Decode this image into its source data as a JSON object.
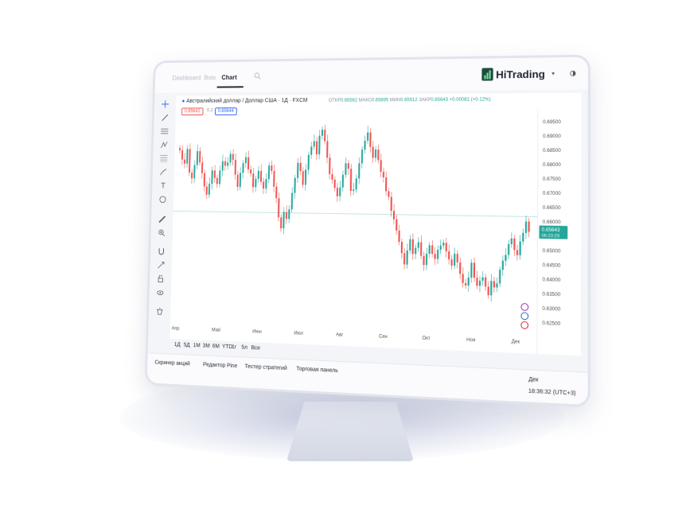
{
  "nav": {
    "tabs": [
      {
        "label": "Dashboard",
        "active": false
      },
      {
        "label": "Bots",
        "active": false
      },
      {
        "label": "Chart",
        "active": true
      }
    ],
    "search_icon": "search-icon"
  },
  "brand": {
    "name": "HiTrading",
    "colors": {
      "mark": "#1d4d3d",
      "accent": "#7be0a3"
    }
  },
  "toolbar": {
    "icons": [
      "crosshair-icon",
      "trend-line-icon",
      "horizontal-lines-icon",
      "pattern-icon",
      "fib-icon",
      "brush-icon",
      "text-icon",
      "emoji-icon",
      "ruler-icon",
      "zoom-in-icon",
      "magnet-icon",
      "lock-drawing-icon",
      "unlock-icon",
      "eye-icon",
      "trash-icon"
    ]
  },
  "symbol": {
    "title": "Австралийский доллар / Доллар США · 1Д · FXCM",
    "sell_price": "0.65642",
    "spread": "0.2",
    "buy_price": "0.65644",
    "open_label": "ОТКР",
    "open": "0.65562",
    "high_label": "МАКС",
    "high": "0.65895",
    "low_label": "МИН",
    "low": "0.65512",
    "close_label": "ЗАКР",
    "close": "0.65643",
    "change": "+0.00081 (+0.12%)"
  },
  "chart_data": {
    "type": "candlestick",
    "up_color": "#26a69a",
    "down_color": "#ef5350",
    "price_axis": [
      "0.69500",
      "0.69000",
      "0.68500",
      "0.68000",
      "0.67500",
      "0.67000",
      "0.66500",
      "0.66000",
      "0.65500",
      "0.65000",
      "0.64500",
      "0.64000",
      "0.63500",
      "0.63000",
      "0.62500"
    ],
    "ylim": [
      0.6235,
      0.6965
    ],
    "time_axis": [
      "Апр",
      "Май",
      "Июн",
      "Июл",
      "Авг",
      "Сен",
      "Окт",
      "Ноя",
      "Дек"
    ],
    "last_price_label": "0.65643",
    "countdown_label": "06:23:29",
    "reference_line": 0.6617,
    "closes": [
      0.6845,
      0.681,
      0.6795,
      0.685,
      0.6762,
      0.674,
      0.679,
      0.6842,
      0.68,
      0.676,
      0.671,
      0.668,
      0.672,
      0.677,
      0.6742,
      0.672,
      0.677,
      0.6805,
      0.6788,
      0.68,
      0.6832,
      0.681,
      0.6755,
      0.671,
      0.6762,
      0.6798,
      0.682,
      0.6775,
      0.676,
      0.671,
      0.674,
      0.677,
      0.673,
      0.6705,
      0.674,
      0.679,
      0.677,
      0.6712,
      0.667,
      0.66,
      0.656,
      0.662,
      0.6595,
      0.663,
      0.669,
      0.6745,
      0.68,
      0.677,
      0.672,
      0.6775,
      0.683,
      0.686,
      0.688,
      0.6832,
      0.69,
      0.6922,
      0.688,
      0.682,
      0.676,
      0.674,
      0.671,
      0.668,
      0.6712,
      0.6758,
      0.68,
      0.678,
      0.67,
      0.6705,
      0.6745,
      0.68,
      0.685,
      0.6882,
      0.6912,
      0.686,
      0.682,
      0.685,
      0.6812,
      0.677,
      0.675,
      0.67,
      0.668,
      0.663,
      0.66,
      0.656,
      0.652,
      0.648,
      0.644,
      0.649,
      0.653,
      0.6478,
      0.65,
      0.652,
      0.6472,
      0.644,
      0.648,
      0.651,
      0.648,
      0.6462,
      0.6495,
      0.651,
      0.652,
      0.649,
      0.6462,
      0.644,
      0.6482,
      0.6452,
      0.6412,
      0.638,
      0.6372,
      0.64,
      0.6452,
      0.64,
      0.6372,
      0.639,
      0.6402,
      0.637,
      0.634,
      0.639,
      0.6368,
      0.6382,
      0.643,
      0.6462,
      0.6482,
      0.652,
      0.654,
      0.65,
      0.6482,
      0.653,
      0.656,
      0.66,
      0.6564
    ]
  },
  "time_ranges": [
    "1Д",
    "5Д",
    "1М",
    "3М",
    "6М",
    "YTD",
    "1г",
    "5л",
    "Все"
  ],
  "bottom_tabs": [
    "Скринер акций",
    "Редактор Pine",
    "Тестер стратегий",
    "Торговая панель"
  ],
  "bottom": {
    "period": "Дек",
    "clock": "18:36:32 (UTC+3)"
  }
}
